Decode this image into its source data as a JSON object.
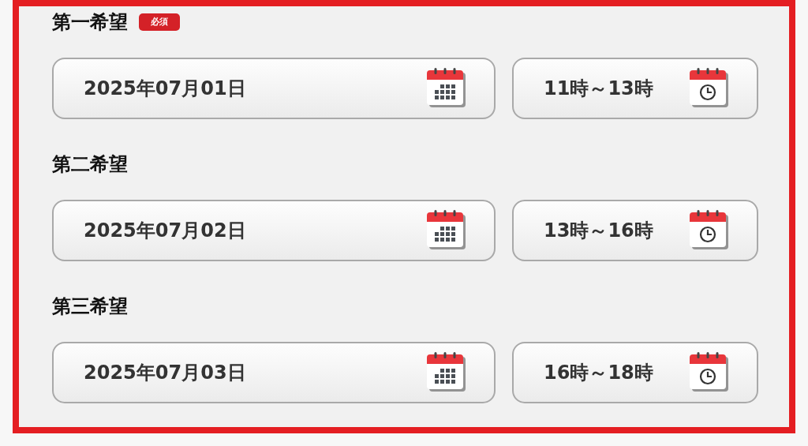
{
  "preferences": [
    {
      "label": "第一希望",
      "badge": "必須",
      "date": "2025年07月01日",
      "time": "11時～13時"
    },
    {
      "label": "第二希望",
      "date": "2025年07月02日",
      "time": "13時～16時"
    },
    {
      "label": "第三希望",
      "date": "2025年07月03日",
      "time": "16時～18時"
    }
  ]
}
